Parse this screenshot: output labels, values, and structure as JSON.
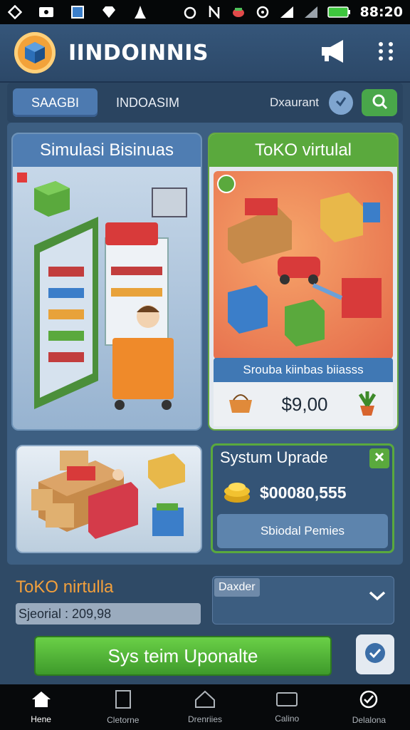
{
  "status_bar": {
    "time": "88:20",
    "left_icons": [
      "diamond-icon",
      "wallet-icon",
      "square-icon",
      "gem-icon",
      "clean-icon"
    ],
    "right_icons": [
      "alarm-icon",
      "n-icon",
      "hand-icon",
      "vpn-icon",
      "signal-icon",
      "wifi-icon",
      "battery-icon"
    ]
  },
  "header": {
    "title": "IINDOINNIS",
    "logo_icon": "cube-logo-icon",
    "actions": [
      "megaphone-icon",
      "grid-menu-icon"
    ]
  },
  "tabs": {
    "items": [
      {
        "label": "SAAGBI",
        "active": true
      },
      {
        "label": "INDOASIM",
        "active": false
      }
    ],
    "filter_label": "Dxaurant"
  },
  "cards": {
    "simulation": {
      "title": "Simulasi Bisinuas"
    },
    "toko": {
      "title": "ToKO virtulal",
      "subtitle": "Srouba kiinbas biiasss",
      "price": "$9,00"
    },
    "upgrade": {
      "title": "Systum Uprade",
      "amount": "$00080,555",
      "button_label": "Sbiodal Pemies"
    }
  },
  "bottom_info": {
    "title": "ToKO nirtulla",
    "value": "Sjeorial : 209,98",
    "dropdown_label": "Daxder"
  },
  "cta": {
    "label": "Sys teim Uponalte"
  },
  "bottom_nav": [
    {
      "label": "Hene",
      "icon": "home-icon",
      "active": true
    },
    {
      "label": "Cletorne",
      "icon": "document-icon",
      "active": false
    },
    {
      "label": "Drenriies",
      "icon": "house-outline-icon",
      "active": false
    },
    {
      "label": "Calino",
      "icon": "window-icon",
      "active": false
    },
    {
      "label": "Delalona",
      "icon": "settings-check-icon",
      "active": false
    }
  ],
  "colors": {
    "accent_green": "#5aa93d",
    "header_blue": "#2f4a66",
    "orange_title": "#f3a03c"
  }
}
